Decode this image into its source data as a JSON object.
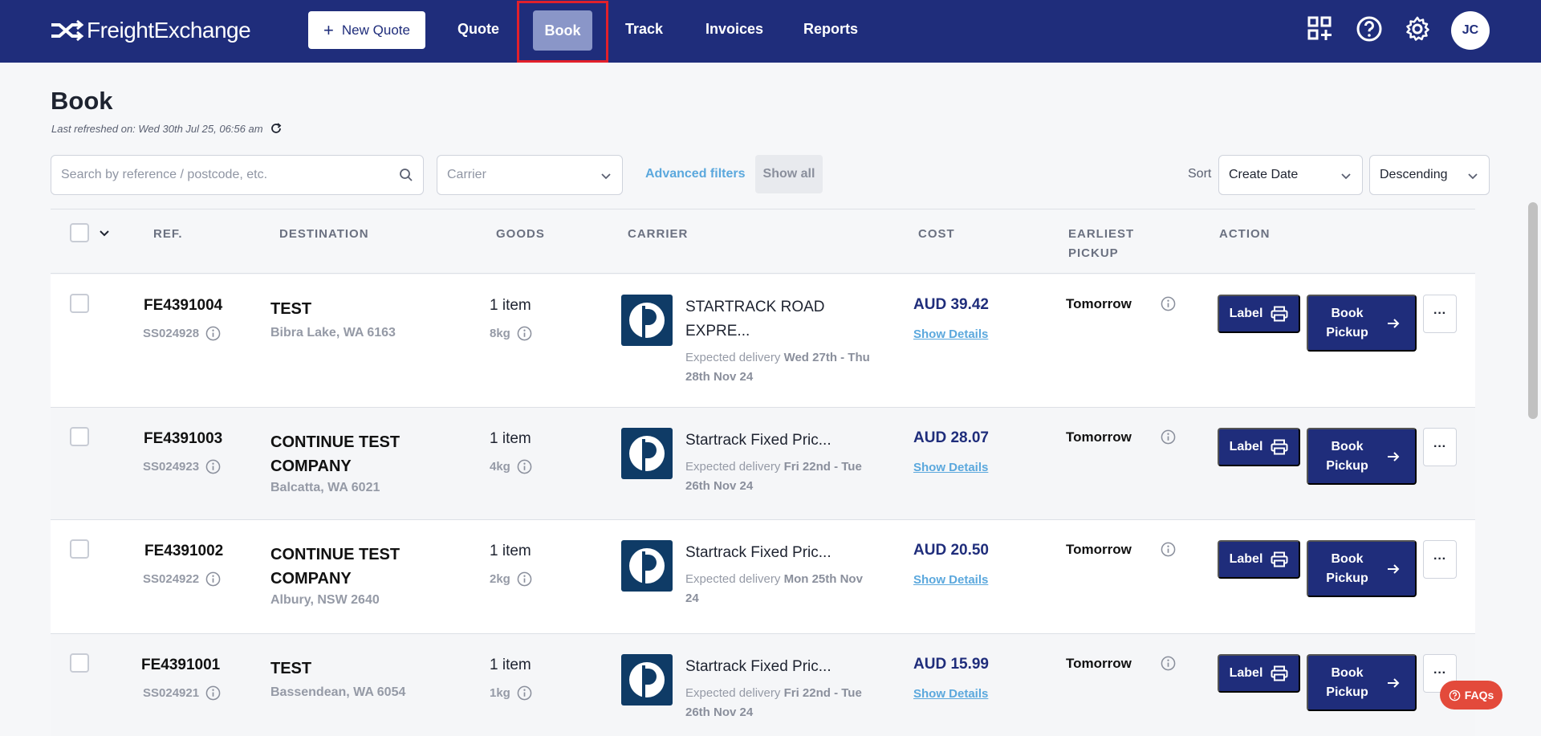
{
  "app": {
    "logo_text": "FreightExchange"
  },
  "nav": {
    "new_quote": "New Quote",
    "quote": "Quote",
    "book": "Book",
    "track": "Track",
    "invoices": "Invoices",
    "reports": "Reports",
    "avatar_initials": "JC"
  },
  "page": {
    "title": "Book",
    "refreshed": "Last refreshed on: Wed 30th Jul 25, 06:56 am"
  },
  "filters": {
    "search_placeholder": "Search by reference / postcode, etc.",
    "carrier_placeholder": "Carrier",
    "advanced_filters": "Advanced filters",
    "show_all": "Show all",
    "sort_label": "Sort",
    "sort_field": "Create Date",
    "sort_order": "Descending"
  },
  "table": {
    "headers": {
      "ref": "REF.",
      "destination": "DESTINATION",
      "goods": "GOODS",
      "carrier": "CARRIER",
      "cost": "COST",
      "earliest_pickup_1": "EARLIEST",
      "earliest_pickup_2": "PICKUP",
      "action": "ACTION"
    },
    "rows": [
      {
        "ref": "FE4391004",
        "subref": "SS024928",
        "dest_name": "TEST",
        "dest_place": "Bibra Lake, WA 6163",
        "goods": "1 item",
        "weight": "8kg",
        "carrier": "STARTRACK ROAD EXPRE...",
        "exp_prefix": "Expected delivery ",
        "exp_dates": "Wed 27th - Thu 28th Nov 24",
        "cost": "AUD 39.42",
        "show_details": "Show Details",
        "pickup": "Tomorrow",
        "label": "Label",
        "book": "Book Pickup",
        "more": "···"
      },
      {
        "ref": "FE4391003",
        "subref": "SS024923",
        "dest_name": "CONTINUE TEST COMPANY",
        "dest_place": "Balcatta, WA 6021",
        "goods": "1 item",
        "weight": "4kg",
        "carrier": "Startrack Fixed Pric...",
        "exp_prefix": "Expected delivery ",
        "exp_dates": "Fri 22nd - Tue 26th Nov 24",
        "cost": "AUD 28.07",
        "show_details": "Show Details",
        "pickup": "Tomorrow",
        "label": "Label",
        "book": "Book Pickup",
        "more": "···"
      },
      {
        "ref": "FE4391002",
        "subref": "SS024922",
        "dest_name": "CONTINUE TEST COMPANY",
        "dest_place": "Albury, NSW 2640",
        "goods": "1 item",
        "weight": "2kg",
        "carrier": "Startrack Fixed Pric...",
        "exp_prefix": "Expected delivery ",
        "exp_dates": "Mon 25th Nov 24",
        "cost": "AUD 20.50",
        "show_details": "Show Details",
        "pickup": "Tomorrow",
        "label": "Label",
        "book": "Book Pickup",
        "more": "···"
      },
      {
        "ref": "FE4391001",
        "subref": "SS024921",
        "dest_name": "TEST",
        "dest_place": "Bassendean, WA 6054",
        "goods": "1 item",
        "weight": "1kg",
        "carrier": "Startrack Fixed Pric...",
        "exp_prefix": "Expected delivery ",
        "exp_dates": "Fri 22nd - Tue 26th Nov 24",
        "cost": "AUD 15.99",
        "show_details": "Show Details",
        "pickup": "Tomorrow",
        "label": "Label",
        "book": "Book Pickup",
        "more": "···"
      }
    ]
  },
  "faqs": "FAQs",
  "colors": {
    "navbar": "#1f2d7b",
    "accent": "#5ba8dd",
    "highlight": "#e2202b",
    "faqs": "#e34a3b"
  }
}
